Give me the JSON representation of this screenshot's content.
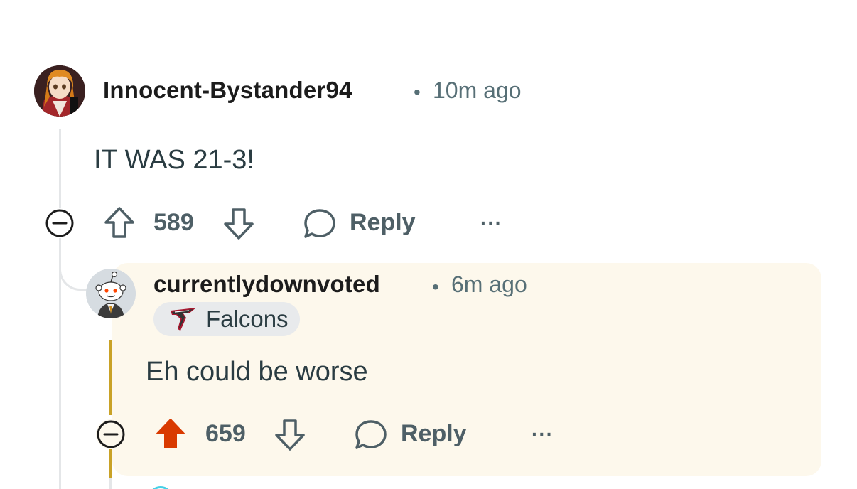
{
  "comments": [
    {
      "username": "Innocent-Bystander94",
      "separator": "•",
      "time": "10m ago",
      "body": "IT WAS 21-3!",
      "votes": "589",
      "reply_label": "Reply",
      "more_label": "···",
      "upvoted": false,
      "avatar_icon": "anime-avatar-icon"
    },
    {
      "username": "currentlydownvoted",
      "separator": "•",
      "time": "6m ago",
      "flair": "Falcons",
      "flair_icon": "falcons-logo-icon",
      "body": "Eh could be worse",
      "votes": "659",
      "reply_label": "Reply",
      "more_label": "···",
      "upvoted": true,
      "avatar_icon": "snoo-avatar-icon"
    }
  ],
  "colors": {
    "upvote_active": "#d93a00",
    "highlight_bg": "#fdf8ec",
    "thread_accent": "#c9a227",
    "text_muted": "#576f76"
  }
}
